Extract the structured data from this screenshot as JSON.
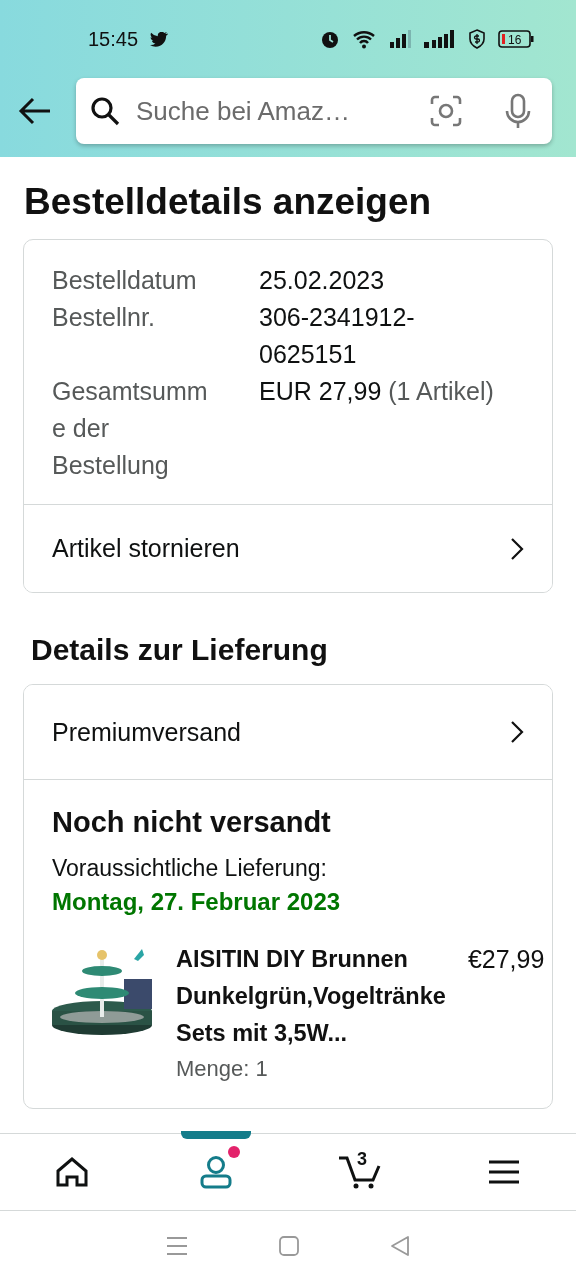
{
  "status_bar": {
    "time": "15:45",
    "battery": "16"
  },
  "search": {
    "placeholder": "Suche bei Amaz…"
  },
  "page_title": "Bestelldetails anzeigen",
  "order": {
    "rows": [
      {
        "label": "Bestelldatum",
        "value": "25.02.2023"
      },
      {
        "label": "Bestellnr.",
        "value": "306-2341912-0625151"
      },
      {
        "label": "Gesamtsumme der Bestellung",
        "value": "EUR 27,99",
        "note": "(1 Artikel)"
      }
    ],
    "action": "Artikel stornieren"
  },
  "delivery": {
    "title": "Details zur Lieferung",
    "shipping": "Premiumversand",
    "status": "Noch nicht versandt",
    "expected_label": "Voraussichtliche Lieferung:",
    "expected_date": "Montag, 27. Februar 2023",
    "item": {
      "kind": "picture",
      "title": "AISITIN DIY Brunnen Dunkelgrün,Vogeltränke Sets mit 3,5W...",
      "price": "€27,99",
      "quantity": "Menge: 1"
    }
  },
  "bottom_nav": [
    {
      "kind": "home",
      "selected": false,
      "dot": false
    },
    {
      "kind": "account",
      "selected": true,
      "dot": true
    },
    {
      "kind": "cart",
      "selected": false,
      "dot": false,
      "count": "3"
    },
    {
      "kind": "menu",
      "selected": false,
      "dot": false
    }
  ]
}
